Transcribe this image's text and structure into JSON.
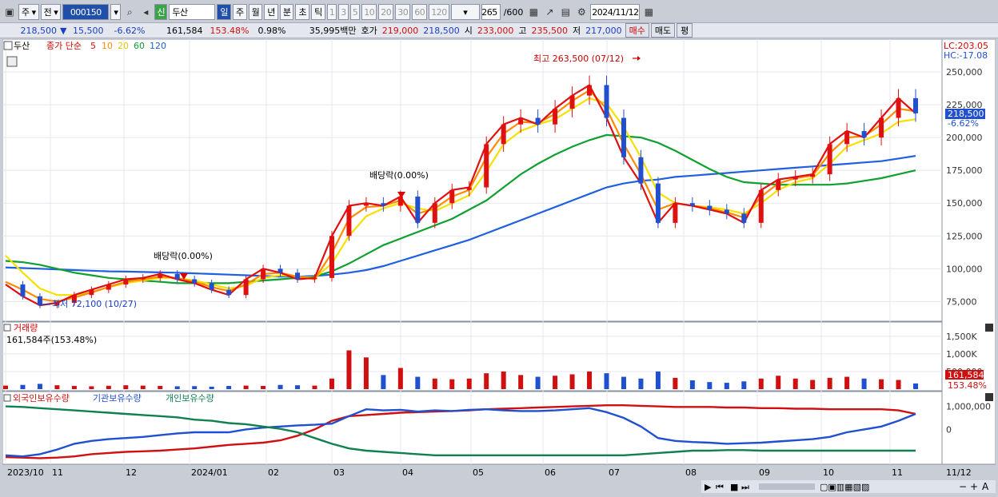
{
  "toolbar": {
    "market": "주",
    "prev": "전",
    "code": "000150",
    "badge": "신",
    "name": "두산",
    "periods": [
      "일",
      "주",
      "월",
      "년",
      "분",
      "초",
      "틱"
    ],
    "active_period": "일",
    "intervals": [
      "1",
      "3",
      "5",
      "10",
      "20",
      "30",
      "60",
      "120"
    ],
    "count": "265",
    "count_max": "/600",
    "date": "2024/11/12"
  },
  "quote": {
    "price": "218,500",
    "arrow": "▼",
    "change": "15,500",
    "change_pct": "-6.62%",
    "volume": "161,584",
    "volume_ratio": "153.48%",
    "turnover": "0.98%",
    "amount": "35,995백만",
    "hoga_label": "호가",
    "ask": "219,000",
    "bid": "218,500",
    "open_label": "시",
    "open": "233,000",
    "high_label": "고",
    "high": "235,500",
    "low_label": "저",
    "low": "217,000",
    "buy": "매수",
    "sell": "매도",
    "eval": "평"
  },
  "price_panel": {
    "name_tag": "두산",
    "indicator": "종가 단순",
    "ma_periods": [
      "5",
      "10",
      "20",
      "60",
      "120"
    ],
    "ma_colors": [
      "#e01010",
      "#ff8c00",
      "#f5e000",
      "#10a030",
      "#2060e0"
    ],
    "lc": "LC:203.05",
    "hc": "HC:-17.08",
    "y_ticks": [
      "250,000",
      "225,000",
      "200,000",
      "175,000",
      "150,000",
      "125,000",
      "100,000",
      "75,000"
    ],
    "current_price_tag": "218,500",
    "current_pct_tag": "-6.62%",
    "annot_high": "최고 263,500 (07/12)",
    "annot_low": "최저 72,100 (10/27)",
    "annot_div1": "배당락(0.00%)",
    "annot_div2": "배당락(0.00%)"
  },
  "volume_panel": {
    "title": "거래량",
    "value": "161,584주(153.48%)",
    "y_ticks": [
      "1,500K",
      "1,000K",
      "500,000"
    ],
    "tag_value": "161,584",
    "tag_pct": "153.48%"
  },
  "holder_panel": {
    "series": [
      "외국인보유수량",
      "기관보유수량",
      "개인보유수량"
    ],
    "colors": [
      "#d01010",
      "#2050d0",
      "#108050"
    ],
    "y_ticks": [
      "1,000,000",
      "0"
    ]
  },
  "x_axis": [
    "2023/10",
    "11",
    "12",
    "2024/01",
    "02",
    "03",
    "04",
    "05",
    "06",
    "07",
    "08",
    "09",
    "10",
    "11",
    "11/12"
  ],
  "chart_data": {
    "type": "candlestick",
    "xlabel": "",
    "ylabel": "",
    "ylim": [
      60000,
      275000
    ],
    "x_ticks": [
      "2023/10",
      "11",
      "12",
      "2024/01",
      "02",
      "03",
      "04",
      "05",
      "06",
      "07",
      "08",
      "09",
      "10",
      "11"
    ],
    "series": [
      {
        "name": "5",
        "values": [
          88000,
          79000,
          72100,
          74000,
          80000,
          84000,
          88000,
          92000,
          93000,
          96000,
          92000,
          89000,
          84000,
          80000,
          92000,
          100000,
          97000,
          92000,
          93000,
          125000,
          148000,
          150000,
          148000,
          155000,
          135000,
          150000,
          160000,
          162000,
          195000,
          210000,
          215000,
          210000,
          222000,
          232000,
          240000,
          215000,
          185000,
          165000,
          135000,
          150000,
          148000,
          145000,
          142000,
          135000,
          160000,
          168000,
          170000,
          172000,
          195000,
          205000,
          200000,
          215000,
          230000,
          218500
        ]
      },
      {
        "name": "10",
        "values": [
          90000,
          84000,
          77000,
          75000,
          78000,
          82000,
          86000,
          90000,
          92000,
          94000,
          93000,
          90000,
          86000,
          83000,
          88000,
          96000,
          97000,
          94000,
          92000,
          112000,
          138000,
          147000,
          148000,
          152000,
          142000,
          146000,
          155000,
          160000,
          185000,
          203000,
          212000,
          211000,
          218000,
          228000,
          236000,
          222000,
          195000,
          172000,
          145000,
          150000,
          148000,
          146000,
          143000,
          139000,
          155000,
          165000,
          169000,
          171000,
          188000,
          200000,
          201000,
          210000,
          222000,
          220000
        ]
      },
      {
        "name": "20",
        "values": [
          110000,
          97000,
          85000,
          80000,
          80000,
          82000,
          86000,
          89000,
          91000,
          93000,
          93000,
          91000,
          88000,
          85000,
          87000,
          93000,
          95000,
          94000,
          93000,
          104000,
          125000,
          140000,
          146000,
          150000,
          146000,
          144000,
          150000,
          156000,
          174000,
          195000,
          205000,
          210000,
          214000,
          222000,
          230000,
          226000,
          208000,
          185000,
          158000,
          150000,
          148000,
          147000,
          145000,
          142000,
          150000,
          160000,
          166000,
          169000,
          180000,
          193000,
          198000,
          203000,
          212000,
          214000
        ]
      },
      {
        "name": "60",
        "values": [
          106000,
          105000,
          103000,
          100000,
          97000,
          95000,
          93000,
          92000,
          91000,
          90000,
          89000,
          89000,
          89000,
          89000,
          90000,
          91000,
          92000,
          93000,
          94000,
          98000,
          104000,
          111000,
          118000,
          123000,
          128000,
          133000,
          138000,
          145000,
          152000,
          162000,
          172000,
          180000,
          187000,
          193000,
          198000,
          202000,
          201000,
          200000,
          196000,
          190000,
          183000,
          176000,
          170000,
          166000,
          165000,
          164000,
          164000,
          164000,
          164000,
          165000,
          167000,
          169000,
          172000,
          175000
        ]
      },
      {
        "name": "120",
        "values": [
          101000,
          100500,
          100000,
          99500,
          99000,
          98500,
          98000,
          97800,
          97500,
          97200,
          97000,
          96500,
          96000,
          95500,
          95000,
          94500,
          94000,
          94000,
          94500,
          95500,
          97000,
          99000,
          102000,
          106000,
          110000,
          114000,
          118000,
          122000,
          127000,
          132000,
          137000,
          142000,
          147000,
          152000,
          157000,
          162000,
          165000,
          167000,
          168000,
          170000,
          171000,
          172000,
          173000,
          174000,
          175000,
          176000,
          177000,
          178000,
          179000,
          180000,
          181000,
          182000,
          184000,
          186000
        ]
      }
    ],
    "volume": [
      100,
      120,
      150,
      110,
      90,
      80,
      95,
      110,
      100,
      90,
      80,
      85,
      70,
      90,
      100,
      90,
      120,
      110,
      100,
      300,
      1100,
      900,
      400,
      600,
      350,
      300,
      280,
      300,
      450,
      500,
      400,
      350,
      380,
      420,
      500,
      450,
      350,
      300,
      500,
      320,
      250,
      200,
      180,
      220,
      300,
      380,
      300,
      260,
      320,
      350,
      300,
      280,
      260,
      161.584
    ],
    "holders": {
      "외국인보유수량": [
        0.07,
        0.06,
        0.05,
        0.06,
        0.08,
        0.12,
        0.14,
        0.16,
        0.17,
        0.18,
        0.2,
        0.22,
        0.25,
        0.28,
        0.3,
        0.32,
        0.36,
        0.44,
        0.55,
        0.7,
        0.78,
        0.8,
        0.82,
        0.84,
        0.85,
        0.86,
        0.87,
        0.88,
        0.9,
        0.91,
        0.92,
        0.93,
        0.94,
        0.95,
        0.96,
        0.97,
        0.97,
        0.96,
        0.95,
        0.94,
        0.94,
        0.94,
        0.93,
        0.93,
        0.92,
        0.92,
        0.91,
        0.91,
        0.9,
        0.9,
        0.9,
        0.9,
        0.88,
        0.82
      ],
      "기관보유수량": [
        0.1,
        0.08,
        0.12,
        0.2,
        0.3,
        0.35,
        0.38,
        0.4,
        0.42,
        0.45,
        0.48,
        0.5,
        0.5,
        0.5,
        0.55,
        0.58,
        0.6,
        0.62,
        0.63,
        0.65,
        0.78,
        0.9,
        0.88,
        0.89,
        0.86,
        0.88,
        0.87,
        0.89,
        0.9,
        0.88,
        0.87,
        0.87,
        0.88,
        0.9,
        0.92,
        0.85,
        0.75,
        0.6,
        0.4,
        0.35,
        0.33,
        0.32,
        0.3,
        0.31,
        0.32,
        0.34,
        0.36,
        0.38,
        0.42,
        0.5,
        0.55,
        0.6,
        0.7,
        0.82
      ],
      "개인보유수량": [
        0.95,
        0.94,
        0.92,
        0.9,
        0.88,
        0.86,
        0.84,
        0.82,
        0.8,
        0.78,
        0.76,
        0.72,
        0.7,
        0.66,
        0.64,
        0.6,
        0.56,
        0.5,
        0.4,
        0.3,
        0.22,
        0.18,
        0.16,
        0.14,
        0.12,
        0.1,
        0.1,
        0.1,
        0.1,
        0.1,
        0.1,
        0.1,
        0.1,
        0.1,
        0.1,
        0.1,
        0.1,
        0.12,
        0.14,
        0.16,
        0.18,
        0.18,
        0.19,
        0.19,
        0.18,
        0.18,
        0.18,
        0.18,
        0.18,
        0.18,
        0.18,
        0.18,
        0.18,
        0.18
      ]
    }
  }
}
